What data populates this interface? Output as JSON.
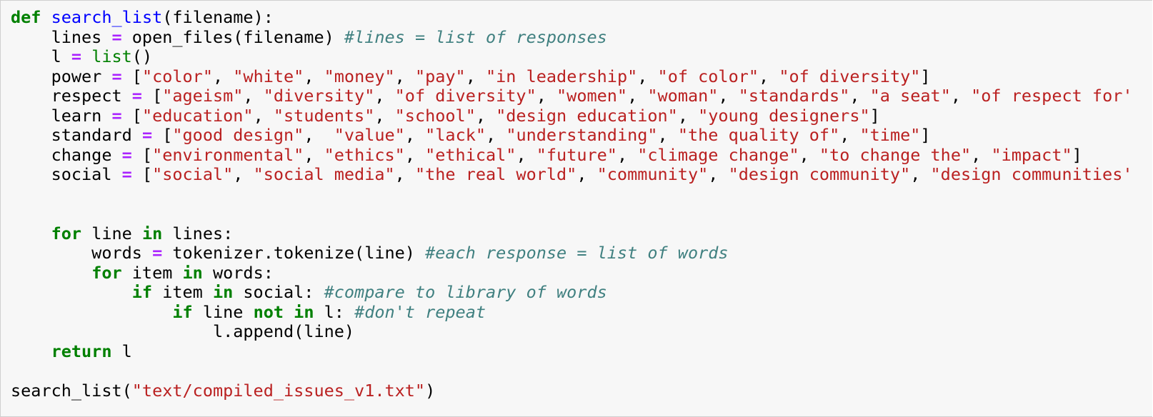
{
  "code_cell": {
    "lines": [
      [
        {
          "t": "def",
          "c": "kw"
        },
        {
          "t": " ",
          "c": "pl"
        },
        {
          "t": "search_list",
          "c": "fn"
        },
        {
          "t": "(filename):",
          "c": "pl"
        }
      ],
      [
        {
          "t": "    lines ",
          "c": "pl"
        },
        {
          "t": "=",
          "c": "op"
        },
        {
          "t": " open_files(filename) ",
          "c": "pl"
        },
        {
          "t": "#lines = list of responses",
          "c": "cm"
        }
      ],
      [
        {
          "t": "    l ",
          "c": "pl"
        },
        {
          "t": "=",
          "c": "op"
        },
        {
          "t": " ",
          "c": "pl"
        },
        {
          "t": "list",
          "c": "bi"
        },
        {
          "t": "()",
          "c": "pl"
        }
      ],
      [
        {
          "t": "    power ",
          "c": "pl"
        },
        {
          "t": "=",
          "c": "op"
        },
        {
          "t": " [",
          "c": "pl"
        },
        {
          "t": "\"color\"",
          "c": "str"
        },
        {
          "t": ", ",
          "c": "pl"
        },
        {
          "t": "\"white\"",
          "c": "str"
        },
        {
          "t": ", ",
          "c": "pl"
        },
        {
          "t": "\"money\"",
          "c": "str"
        },
        {
          "t": ", ",
          "c": "pl"
        },
        {
          "t": "\"pay\"",
          "c": "str"
        },
        {
          "t": ", ",
          "c": "pl"
        },
        {
          "t": "\"in leadership\"",
          "c": "str"
        },
        {
          "t": ", ",
          "c": "pl"
        },
        {
          "t": "\"of color\"",
          "c": "str"
        },
        {
          "t": ", ",
          "c": "pl"
        },
        {
          "t": "\"of diversity\"",
          "c": "str"
        },
        {
          "t": "]",
          "c": "pl"
        }
      ],
      [
        {
          "t": "    respect ",
          "c": "pl"
        },
        {
          "t": "=",
          "c": "op"
        },
        {
          "t": " [",
          "c": "pl"
        },
        {
          "t": "\"ageism\"",
          "c": "str"
        },
        {
          "t": ", ",
          "c": "pl"
        },
        {
          "t": "\"diversity\"",
          "c": "str"
        },
        {
          "t": ", ",
          "c": "pl"
        },
        {
          "t": "\"of diversity\"",
          "c": "str"
        },
        {
          "t": ", ",
          "c": "pl"
        },
        {
          "t": "\"women\"",
          "c": "str"
        },
        {
          "t": ", ",
          "c": "pl"
        },
        {
          "t": "\"woman\"",
          "c": "str"
        },
        {
          "t": ", ",
          "c": "pl"
        },
        {
          "t": "\"standards\"",
          "c": "str"
        },
        {
          "t": ", ",
          "c": "pl"
        },
        {
          "t": "\"a seat\"",
          "c": "str"
        },
        {
          "t": ", ",
          "c": "pl"
        },
        {
          "t": "\"of respect for'",
          "c": "str"
        }
      ],
      [
        {
          "t": "    learn ",
          "c": "pl"
        },
        {
          "t": "=",
          "c": "op"
        },
        {
          "t": " [",
          "c": "pl"
        },
        {
          "t": "\"education\"",
          "c": "str"
        },
        {
          "t": ", ",
          "c": "pl"
        },
        {
          "t": "\"students\"",
          "c": "str"
        },
        {
          "t": ", ",
          "c": "pl"
        },
        {
          "t": "\"school\"",
          "c": "str"
        },
        {
          "t": ", ",
          "c": "pl"
        },
        {
          "t": "\"design education\"",
          "c": "str"
        },
        {
          "t": ", ",
          "c": "pl"
        },
        {
          "t": "\"young designers\"",
          "c": "str"
        },
        {
          "t": "]",
          "c": "pl"
        }
      ],
      [
        {
          "t": "    standard ",
          "c": "pl"
        },
        {
          "t": "=",
          "c": "op"
        },
        {
          "t": " [",
          "c": "pl"
        },
        {
          "t": "\"good design\"",
          "c": "str"
        },
        {
          "t": ",  ",
          "c": "pl"
        },
        {
          "t": "\"value\"",
          "c": "str"
        },
        {
          "t": ", ",
          "c": "pl"
        },
        {
          "t": "\"lack\"",
          "c": "str"
        },
        {
          "t": ", ",
          "c": "pl"
        },
        {
          "t": "\"understanding\"",
          "c": "str"
        },
        {
          "t": ", ",
          "c": "pl"
        },
        {
          "t": "\"the quality of\"",
          "c": "str"
        },
        {
          "t": ", ",
          "c": "pl"
        },
        {
          "t": "\"time\"",
          "c": "str"
        },
        {
          "t": "]",
          "c": "pl"
        }
      ],
      [
        {
          "t": "    change ",
          "c": "pl"
        },
        {
          "t": "=",
          "c": "op"
        },
        {
          "t": " [",
          "c": "pl"
        },
        {
          "t": "\"environmental\"",
          "c": "str"
        },
        {
          "t": ", ",
          "c": "pl"
        },
        {
          "t": "\"ethics\"",
          "c": "str"
        },
        {
          "t": ", ",
          "c": "pl"
        },
        {
          "t": "\"ethical\"",
          "c": "str"
        },
        {
          "t": ", ",
          "c": "pl"
        },
        {
          "t": "\"future\"",
          "c": "str"
        },
        {
          "t": ", ",
          "c": "pl"
        },
        {
          "t": "\"climage change\"",
          "c": "str"
        },
        {
          "t": ", ",
          "c": "pl"
        },
        {
          "t": "\"to change the\"",
          "c": "str"
        },
        {
          "t": ", ",
          "c": "pl"
        },
        {
          "t": "\"impact\"",
          "c": "str"
        },
        {
          "t": "]",
          "c": "pl"
        }
      ],
      [
        {
          "t": "    social ",
          "c": "pl"
        },
        {
          "t": "=",
          "c": "op"
        },
        {
          "t": " [",
          "c": "pl"
        },
        {
          "t": "\"social\"",
          "c": "str"
        },
        {
          "t": ", ",
          "c": "pl"
        },
        {
          "t": "\"social media\"",
          "c": "str"
        },
        {
          "t": ", ",
          "c": "pl"
        },
        {
          "t": "\"the real world\"",
          "c": "str"
        },
        {
          "t": ", ",
          "c": "pl"
        },
        {
          "t": "\"community\"",
          "c": "str"
        },
        {
          "t": ", ",
          "c": "pl"
        },
        {
          "t": "\"design community\"",
          "c": "str"
        },
        {
          "t": ", ",
          "c": "pl"
        },
        {
          "t": "\"design communities'",
          "c": "str"
        }
      ],
      [],
      [],
      [
        {
          "t": "    ",
          "c": "pl"
        },
        {
          "t": "for",
          "c": "kw"
        },
        {
          "t": " line ",
          "c": "pl"
        },
        {
          "t": "in",
          "c": "kw"
        },
        {
          "t": " lines:",
          "c": "pl"
        }
      ],
      [
        {
          "t": "        words ",
          "c": "pl"
        },
        {
          "t": "=",
          "c": "op"
        },
        {
          "t": " tokenizer.tokenize(line) ",
          "c": "pl"
        },
        {
          "t": "#each response = list of words",
          "c": "cm"
        }
      ],
      [
        {
          "t": "        ",
          "c": "pl"
        },
        {
          "t": "for",
          "c": "kw"
        },
        {
          "t": " item ",
          "c": "pl"
        },
        {
          "t": "in",
          "c": "kw"
        },
        {
          "t": " words:",
          "c": "pl"
        }
      ],
      [
        {
          "t": "            ",
          "c": "pl"
        },
        {
          "t": "if",
          "c": "kw"
        },
        {
          "t": " item ",
          "c": "pl"
        },
        {
          "t": "in",
          "c": "kw"
        },
        {
          "t": " social: ",
          "c": "pl"
        },
        {
          "t": "#compare to library of words",
          "c": "cm"
        }
      ],
      [
        {
          "t": "                ",
          "c": "pl"
        },
        {
          "t": "if",
          "c": "kw"
        },
        {
          "t": " line ",
          "c": "pl"
        },
        {
          "t": "not",
          "c": "kw"
        },
        {
          "t": " ",
          "c": "pl"
        },
        {
          "t": "in",
          "c": "kw"
        },
        {
          "t": " l: ",
          "c": "pl"
        },
        {
          "t": "#don't repeat",
          "c": "cm"
        }
      ],
      [
        {
          "t": "                    l.append(line)",
          "c": "pl"
        }
      ],
      [
        {
          "t": "    ",
          "c": "pl"
        },
        {
          "t": "return",
          "c": "kw"
        },
        {
          "t": " l",
          "c": "pl"
        }
      ],
      [],
      [
        {
          "t": "search_list(",
          "c": "pl"
        },
        {
          "t": "\"text/compiled_issues_v1.txt\"",
          "c": "str"
        },
        {
          "t": ")",
          "c": "pl"
        }
      ]
    ]
  },
  "colors": {
    "cell_background": "#f7f7f7",
    "keyword": "#008000",
    "function_name": "#0000ff",
    "operator": "#aa22ff",
    "string": "#ba2121",
    "comment": "#408080",
    "plain": "#000000"
  }
}
